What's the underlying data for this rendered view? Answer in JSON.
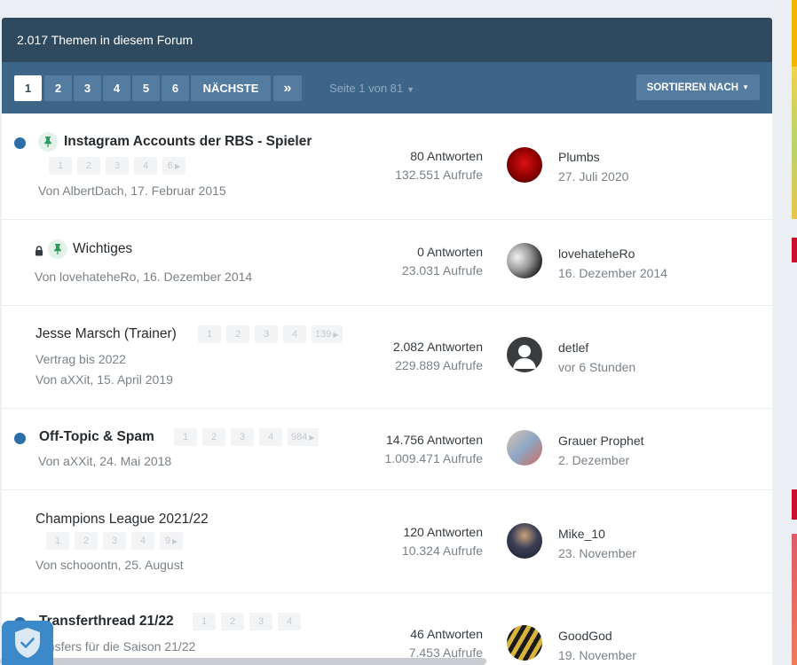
{
  "header": {
    "title": "2.017 Themen in diesem Forum"
  },
  "pagination": {
    "pages": [
      "1",
      "2",
      "3",
      "4",
      "5",
      "6"
    ],
    "active": "1",
    "next_label": "NÄCHSTE",
    "last_icon": "»",
    "page_info": "Seite 1 von 81",
    "sort_label": "SORTIEREN NACH"
  },
  "topics": [
    {
      "title": "Instagram Accounts der RBS - Spieler",
      "pages": [
        "1",
        "2",
        "3",
        "4",
        "6"
      ],
      "byline": "Von AlbertDach, 17. Februar 2015",
      "replies": "80 Antworten",
      "views": "132.551 Aufrufe",
      "last_user": "Plumbs",
      "last_date": "27. Juli 2020"
    },
    {
      "title": "Wichtiges",
      "byline": "Von lovehateheRo, 16. Dezember 2014",
      "replies": "0 Antworten",
      "views": "23.031 Aufrufe",
      "last_user": "lovehateheRo",
      "last_date": "16. Dezember 2014"
    },
    {
      "title": "Jesse Marsch (Trainer)",
      "pages": [
        "1",
        "2",
        "3",
        "4",
        "139"
      ],
      "description": "Vertrag bis 2022",
      "byline": "Von aXXit, 15. April 2019",
      "replies": "2.082 Antworten",
      "views": "229.889 Aufrufe",
      "last_user": "detlef",
      "last_date": "vor 6 Stunden"
    },
    {
      "title": "Off-Topic & Spam",
      "pages": [
        "1",
        "2",
        "3",
        "4",
        "984"
      ],
      "byline": "Von aXXit, 24. Mai 2018",
      "replies": "14.756 Antworten",
      "views": "1.009.471 Aufrufe",
      "last_user": "Grauer Prophet",
      "last_date": "2. Dezember"
    },
    {
      "title": "Champions League 2021/22",
      "pages": [
        "1",
        "2",
        "3",
        "4",
        "9"
      ],
      "byline": "Von schooontn, 25. August",
      "replies": "120 Antworten",
      "views": "10.324 Aufrufe",
      "last_user": "Mike_10",
      "last_date": "23. November"
    },
    {
      "title": "Transferthread 21/22",
      "pages": [
        "1",
        "2",
        "3",
        "4"
      ],
      "description": "ansfers für die Saison 21/22",
      "replies": "46 Antworten",
      "views": "7.453 Aufrufe",
      "last_user": "GoodGod",
      "last_date": "19. November"
    }
  ],
  "icons": {
    "pin": "pin-icon",
    "lock": "lock-icon",
    "shield": "shield-check-icon"
  },
  "colors": {
    "header_bg": "#2f4a5e",
    "pager_bg": "#3d6588",
    "unread": "#2c6fa8",
    "pin_green": "#2e9a5b",
    "shield": "#3b89c9"
  }
}
